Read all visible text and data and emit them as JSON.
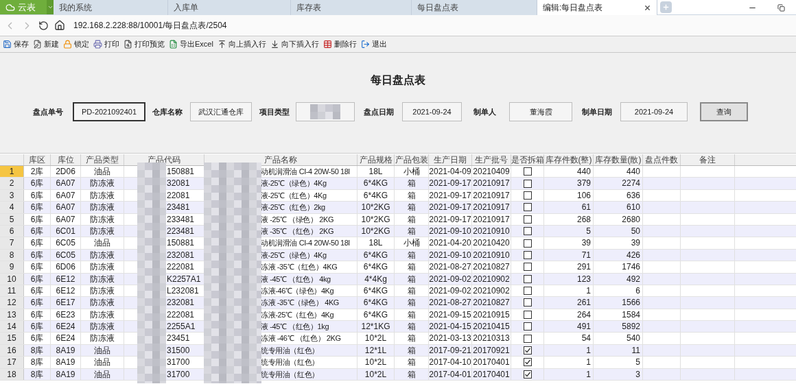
{
  "app_button": {
    "label": "云表"
  },
  "tabs": [
    {
      "label": "我的系统",
      "selected": false
    },
    {
      "label": "入库单",
      "selected": false
    },
    {
      "label": "库存表",
      "selected": false
    },
    {
      "label": "每日盘点表",
      "selected": false
    },
    {
      "label": "编辑:每日盘点表",
      "selected": true
    }
  ],
  "address": "192.168.2.228:88/10001/每日盘点表/2504",
  "toolbar": [
    "保存",
    "新建",
    "锁定",
    "打印",
    "打印预览",
    "导出Excel",
    "向上插入行",
    "向下插入行",
    "删除行",
    "退出"
  ],
  "title": "每日盘点表",
  "form": [
    {
      "kind": "text",
      "label": "盘点单号",
      "value": "PD-2021092401",
      "focused": true
    },
    {
      "kind": "text",
      "label": "仓库名称",
      "value": "武汉汇通仓库",
      "focused": false
    },
    {
      "kind": "blurred",
      "label": "项目类型",
      "focused": false
    },
    {
      "kind": "text",
      "label": "盘点日期",
      "value": "2021-09-24",
      "focused": false
    },
    {
      "kind": "text",
      "label": "制单人",
      "value": "董海霞",
      "focused": false
    },
    {
      "kind": "text",
      "label": "制单日期",
      "value": "2021-09-24",
      "focused": false
    }
  ],
  "query_button": "查询",
  "columns": [
    "库区",
    "库位",
    "产品类型",
    "产品代码",
    "产品名称",
    "产品规格",
    "产品包装",
    "生产日期",
    "生产批号",
    "是否拆箱",
    "库存件数(整)",
    "库存数量(散)",
    "盘点件数",
    "备注"
  ],
  "rows": [
    {
      "selected": true,
      "cells": [
        "1",
        "2库",
        "2D06",
        "油品",
        "150881",
        "动机润滑油 CI-4 20W-50 18l",
        "18L",
        "小桶",
        "2021-04-09",
        "20210409"
      ],
      "unpacked": false,
      "cases": "440",
      "qty": "440"
    },
    {
      "selected": false,
      "cells": [
        "2",
        "6库",
        "6A07",
        "防冻液",
        "32081",
        "液-25℃（绿色）4Kg",
        "6*4KG",
        "箱",
        "2021-09-17",
        "20210917"
      ],
      "unpacked": false,
      "cases": "379",
      "qty": "2274"
    },
    {
      "selected": false,
      "cells": [
        "3",
        "6库",
        "6A07",
        "防冻液",
        "22081",
        "液-25℃（红色）4Kg",
        "6*4KG",
        "箱",
        "2021-09-17",
        "20210917"
      ],
      "unpacked": false,
      "cases": "106",
      "qty": "636"
    },
    {
      "selected": false,
      "cells": [
        "4",
        "6库",
        "6A07",
        "防冻液",
        "23481",
        "液-25℃（红色）2kg",
        "10*2KG",
        "箱",
        "2021-09-17",
        "20210917"
      ],
      "unpacked": false,
      "cases": "61",
      "qty": "610"
    },
    {
      "selected": false,
      "cells": [
        "5",
        "6库",
        "6A07",
        "防冻液",
        "233481",
        "液 -25℃ （绿色） 2KG",
        "10*2KG",
        "箱",
        "2021-09-17",
        "20210917"
      ],
      "unpacked": false,
      "cases": "268",
      "qty": "2680"
    },
    {
      "selected": false,
      "cells": [
        "6",
        "6库",
        "6C01",
        "防冻液",
        "223481",
        "液 -35℃ （红色） 2KG",
        "10*2KG",
        "箱",
        "2021-09-10",
        "20210910"
      ],
      "unpacked": false,
      "cases": "5",
      "qty": "50"
    },
    {
      "selected": false,
      "cells": [
        "7",
        "6库",
        "6C05",
        "油品",
        "150881",
        "动机润滑油 CI-4 20W-50 18l",
        "18L",
        "小桶",
        "2021-04-20",
        "20210420"
      ],
      "unpacked": false,
      "cases": "39",
      "qty": "39"
    },
    {
      "selected": false,
      "cells": [
        "8",
        "6库",
        "6C05",
        "防冻液",
        "232081",
        "液-25℃（绿色）4Kg",
        "6*4KG",
        "箱",
        "2021-09-10",
        "20210910"
      ],
      "unpacked": false,
      "cases": "71",
      "qty": "426"
    },
    {
      "selected": false,
      "cells": [
        "9",
        "6库",
        "6D06",
        "防冻液",
        "222081",
        "冻液 -35℃（红色）4KG",
        "6*4KG",
        "箱",
        "2021-08-27",
        "20210827"
      ],
      "unpacked": false,
      "cases": "291",
      "qty": "1746"
    },
    {
      "selected": false,
      "cells": [
        "10",
        "6库",
        "6E12",
        "防冻液",
        "K2257A1",
        "液 -45℃ （红色） 4kg",
        "4*4Kg",
        "箱",
        "2021-09-02",
        "20210902"
      ],
      "unpacked": false,
      "cases": "123",
      "qty": "492"
    },
    {
      "selected": false,
      "cells": [
        "11",
        "6库",
        "6E12",
        "防冻液",
        "L232081",
        "冻液-46℃（绿色）4Kg",
        "6*4KG",
        "箱",
        "2021-09-02",
        "20210902"
      ],
      "unpacked": false,
      "cases": "1",
      "qty": "6"
    },
    {
      "selected": false,
      "cells": [
        "12",
        "6库",
        "6E17",
        "防冻液",
        "232081",
        "冻液 -35℃（绿色） 4KG",
        "6*4KG",
        "箱",
        "2021-08-27",
        "20210827"
      ],
      "unpacked": false,
      "cases": "261",
      "qty": "1566"
    },
    {
      "selected": false,
      "cells": [
        "13",
        "6库",
        "6E23",
        "防冻液",
        "222081",
        "冻液-25℃（红色）4Kg",
        "6*4KG",
        "箱",
        "2021-09-15",
        "20210915"
      ],
      "unpacked": false,
      "cases": "264",
      "qty": "1584"
    },
    {
      "selected": false,
      "cells": [
        "14",
        "6库",
        "6E24",
        "防冻液",
        "2255A1",
        "液 -45℃ （红色）1kg",
        "12*1KG",
        "箱",
        "2021-04-15",
        "20210415"
      ],
      "unpacked": false,
      "cases": "491",
      "qty": "5892"
    },
    {
      "selected": false,
      "cells": [
        "15",
        "6库",
        "6E24",
        "防冻液",
        "23451",
        "冻液 -46℃ （红色） 2KG",
        "10*2L",
        "箱",
        "2021-03-13",
        "20210313"
      ],
      "unpacked": false,
      "cases": "54",
      "qty": "540"
    },
    {
      "selected": false,
      "cells": [
        "16",
        "8库",
        "8A19",
        "油品",
        "31500",
        "统专用油（红色）",
        "12*1L",
        "箱",
        "2017-09-21",
        "20170921"
      ],
      "unpacked": true,
      "cases": "1",
      "qty": "11"
    },
    {
      "selected": false,
      "cells": [
        "17",
        "8库",
        "8A19",
        "油品",
        "31700",
        "统专用油（红色）",
        "10*2L",
        "箱",
        "2017-04-10",
        "20170401"
      ],
      "unpacked": true,
      "cases": "1",
      "qty": "5"
    },
    {
      "selected": false,
      "cells": [
        "18",
        "8库",
        "8A19",
        "油品",
        "31700",
        "统专用油（红色）",
        "10*2L",
        "箱",
        "2017-04-01",
        "20170401"
      ],
      "unpacked": true,
      "cases": "1",
      "qty": "3"
    }
  ]
}
